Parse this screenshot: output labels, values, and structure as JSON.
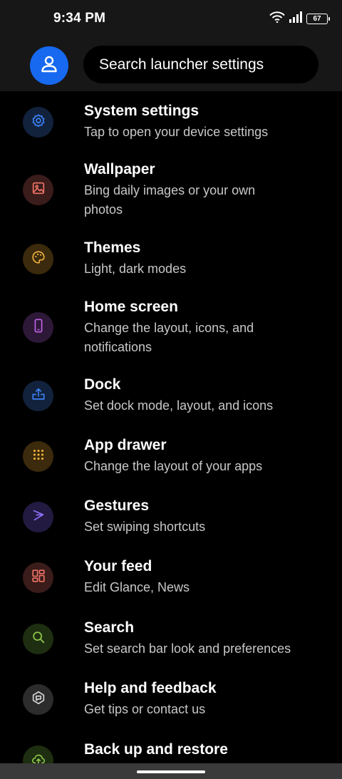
{
  "status": {
    "time": "9:34 PM",
    "battery": "67"
  },
  "search": {
    "placeholder": "Search launcher settings"
  },
  "settings": [
    {
      "title": "System settings",
      "subtitle": "Tap to open your device settings",
      "icon": "gear-icon",
      "color": "#3b82f6",
      "bg": "#12223d"
    },
    {
      "title": "Wallpaper",
      "subtitle": "Bing daily images or your own photos",
      "icon": "image-icon",
      "color": "#f07468",
      "bg": "#3a1c1a"
    },
    {
      "title": "Themes",
      "subtitle": "Light, dark modes",
      "icon": "palette-icon",
      "color": "#f3b33d",
      "bg": "#3b2a0c"
    },
    {
      "title": "Home screen",
      "subtitle": "Change the layout, icons, and notifications",
      "icon": "phone-icon",
      "color": "#c062e8",
      "bg": "#2e1838"
    },
    {
      "title": "Dock",
      "subtitle": "Set dock mode, layout, and icons",
      "icon": "dock-upload-icon",
      "color": "#3b82f6",
      "bg": "#12223d"
    },
    {
      "title": "App drawer",
      "subtitle": "Change the layout of your apps",
      "icon": "grid-dots-icon",
      "color": "#f3b33d",
      "bg": "#3b2a0c"
    },
    {
      "title": "Gestures",
      "subtitle": "Set swiping shortcuts",
      "icon": "gesture-swipe-icon",
      "color": "#8a6cf5",
      "bg": "#221a40"
    },
    {
      "title": "Your feed",
      "subtitle": "Edit Glance, News",
      "icon": "feed-layout-icon",
      "color": "#f07468",
      "bg": "#3a1c1a"
    },
    {
      "title": "Search",
      "subtitle": "Set search bar look and preferences",
      "icon": "search-icon",
      "color": "#8bc34a",
      "bg": "#1e2e10"
    },
    {
      "title": "Help and feedback",
      "subtitle": "Get tips or contact us",
      "icon": "help-chat-icon",
      "color": "#d6d6d6",
      "bg": "#2c2c2c"
    },
    {
      "title": "Back up and restore",
      "subtitle": "",
      "icon": "cloud-backup-icon",
      "color": "#8bc34a",
      "bg": "#1e2e10"
    }
  ]
}
